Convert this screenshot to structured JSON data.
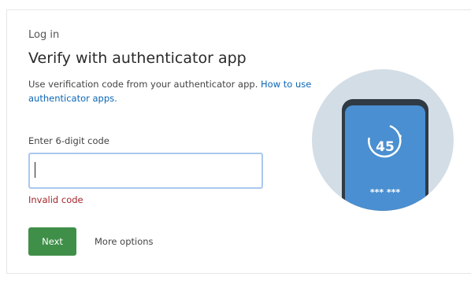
{
  "login": {
    "eyebrow": "Log in",
    "title": "Verify with authenticator app",
    "description_text": "Use verification code from your authenticator app.",
    "description_link": "How to use authenticator apps.",
    "field_label": "Enter 6-digit code",
    "code_value": "",
    "error_text": "Invalid code",
    "next_label": "Next",
    "more_options_label": "More options"
  },
  "illustration": {
    "timer_value": "45",
    "masked_code": "*** ***"
  },
  "colors": {
    "primary_button": "#3f8f48",
    "link": "#0b66b5",
    "error": "#a4262c",
    "input_focus_border": "#a9c8ee",
    "illustration_circle": "#d3dde6",
    "phone_screen": "#4a8fd1",
    "phone_body": "#2f3a45"
  }
}
